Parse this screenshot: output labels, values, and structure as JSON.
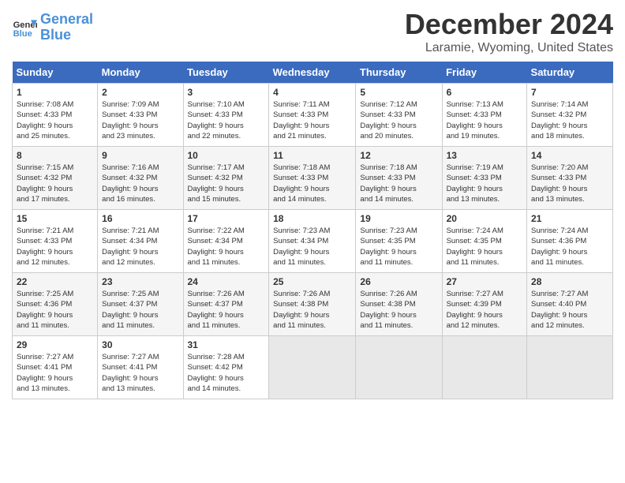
{
  "header": {
    "logo_line1": "General",
    "logo_line2": "Blue",
    "title": "December 2024",
    "subtitle": "Laramie, Wyoming, United States"
  },
  "days_of_week": [
    "Sunday",
    "Monday",
    "Tuesday",
    "Wednesday",
    "Thursday",
    "Friday",
    "Saturday"
  ],
  "weeks": [
    [
      {
        "num": "1",
        "info": "Sunrise: 7:08 AM\nSunset: 4:33 PM\nDaylight: 9 hours\nand 25 minutes."
      },
      {
        "num": "2",
        "info": "Sunrise: 7:09 AM\nSunset: 4:33 PM\nDaylight: 9 hours\nand 23 minutes."
      },
      {
        "num": "3",
        "info": "Sunrise: 7:10 AM\nSunset: 4:33 PM\nDaylight: 9 hours\nand 22 minutes."
      },
      {
        "num": "4",
        "info": "Sunrise: 7:11 AM\nSunset: 4:33 PM\nDaylight: 9 hours\nand 21 minutes."
      },
      {
        "num": "5",
        "info": "Sunrise: 7:12 AM\nSunset: 4:33 PM\nDaylight: 9 hours\nand 20 minutes."
      },
      {
        "num": "6",
        "info": "Sunrise: 7:13 AM\nSunset: 4:33 PM\nDaylight: 9 hours\nand 19 minutes."
      },
      {
        "num": "7",
        "info": "Sunrise: 7:14 AM\nSunset: 4:32 PM\nDaylight: 9 hours\nand 18 minutes."
      }
    ],
    [
      {
        "num": "8",
        "info": "Sunrise: 7:15 AM\nSunset: 4:32 PM\nDaylight: 9 hours\nand 17 minutes."
      },
      {
        "num": "9",
        "info": "Sunrise: 7:16 AM\nSunset: 4:32 PM\nDaylight: 9 hours\nand 16 minutes."
      },
      {
        "num": "10",
        "info": "Sunrise: 7:17 AM\nSunset: 4:32 PM\nDaylight: 9 hours\nand 15 minutes."
      },
      {
        "num": "11",
        "info": "Sunrise: 7:18 AM\nSunset: 4:33 PM\nDaylight: 9 hours\nand 14 minutes."
      },
      {
        "num": "12",
        "info": "Sunrise: 7:18 AM\nSunset: 4:33 PM\nDaylight: 9 hours\nand 14 minutes."
      },
      {
        "num": "13",
        "info": "Sunrise: 7:19 AM\nSunset: 4:33 PM\nDaylight: 9 hours\nand 13 minutes."
      },
      {
        "num": "14",
        "info": "Sunrise: 7:20 AM\nSunset: 4:33 PM\nDaylight: 9 hours\nand 13 minutes."
      }
    ],
    [
      {
        "num": "15",
        "info": "Sunrise: 7:21 AM\nSunset: 4:33 PM\nDaylight: 9 hours\nand 12 minutes."
      },
      {
        "num": "16",
        "info": "Sunrise: 7:21 AM\nSunset: 4:34 PM\nDaylight: 9 hours\nand 12 minutes."
      },
      {
        "num": "17",
        "info": "Sunrise: 7:22 AM\nSunset: 4:34 PM\nDaylight: 9 hours\nand 11 minutes."
      },
      {
        "num": "18",
        "info": "Sunrise: 7:23 AM\nSunset: 4:34 PM\nDaylight: 9 hours\nand 11 minutes."
      },
      {
        "num": "19",
        "info": "Sunrise: 7:23 AM\nSunset: 4:35 PM\nDaylight: 9 hours\nand 11 minutes."
      },
      {
        "num": "20",
        "info": "Sunrise: 7:24 AM\nSunset: 4:35 PM\nDaylight: 9 hours\nand 11 minutes."
      },
      {
        "num": "21",
        "info": "Sunrise: 7:24 AM\nSunset: 4:36 PM\nDaylight: 9 hours\nand 11 minutes."
      }
    ],
    [
      {
        "num": "22",
        "info": "Sunrise: 7:25 AM\nSunset: 4:36 PM\nDaylight: 9 hours\nand 11 minutes."
      },
      {
        "num": "23",
        "info": "Sunrise: 7:25 AM\nSunset: 4:37 PM\nDaylight: 9 hours\nand 11 minutes."
      },
      {
        "num": "24",
        "info": "Sunrise: 7:26 AM\nSunset: 4:37 PM\nDaylight: 9 hours\nand 11 minutes."
      },
      {
        "num": "25",
        "info": "Sunrise: 7:26 AM\nSunset: 4:38 PM\nDaylight: 9 hours\nand 11 minutes."
      },
      {
        "num": "26",
        "info": "Sunrise: 7:26 AM\nSunset: 4:38 PM\nDaylight: 9 hours\nand 11 minutes."
      },
      {
        "num": "27",
        "info": "Sunrise: 7:27 AM\nSunset: 4:39 PM\nDaylight: 9 hours\nand 12 minutes."
      },
      {
        "num": "28",
        "info": "Sunrise: 7:27 AM\nSunset: 4:40 PM\nDaylight: 9 hours\nand 12 minutes."
      }
    ],
    [
      {
        "num": "29",
        "info": "Sunrise: 7:27 AM\nSunset: 4:41 PM\nDaylight: 9 hours\nand 13 minutes."
      },
      {
        "num": "30",
        "info": "Sunrise: 7:27 AM\nSunset: 4:41 PM\nDaylight: 9 hours\nand 13 minutes."
      },
      {
        "num": "31",
        "info": "Sunrise: 7:28 AM\nSunset: 4:42 PM\nDaylight: 9 hours\nand 14 minutes."
      },
      {
        "num": "",
        "info": ""
      },
      {
        "num": "",
        "info": ""
      },
      {
        "num": "",
        "info": ""
      },
      {
        "num": "",
        "info": ""
      }
    ]
  ]
}
